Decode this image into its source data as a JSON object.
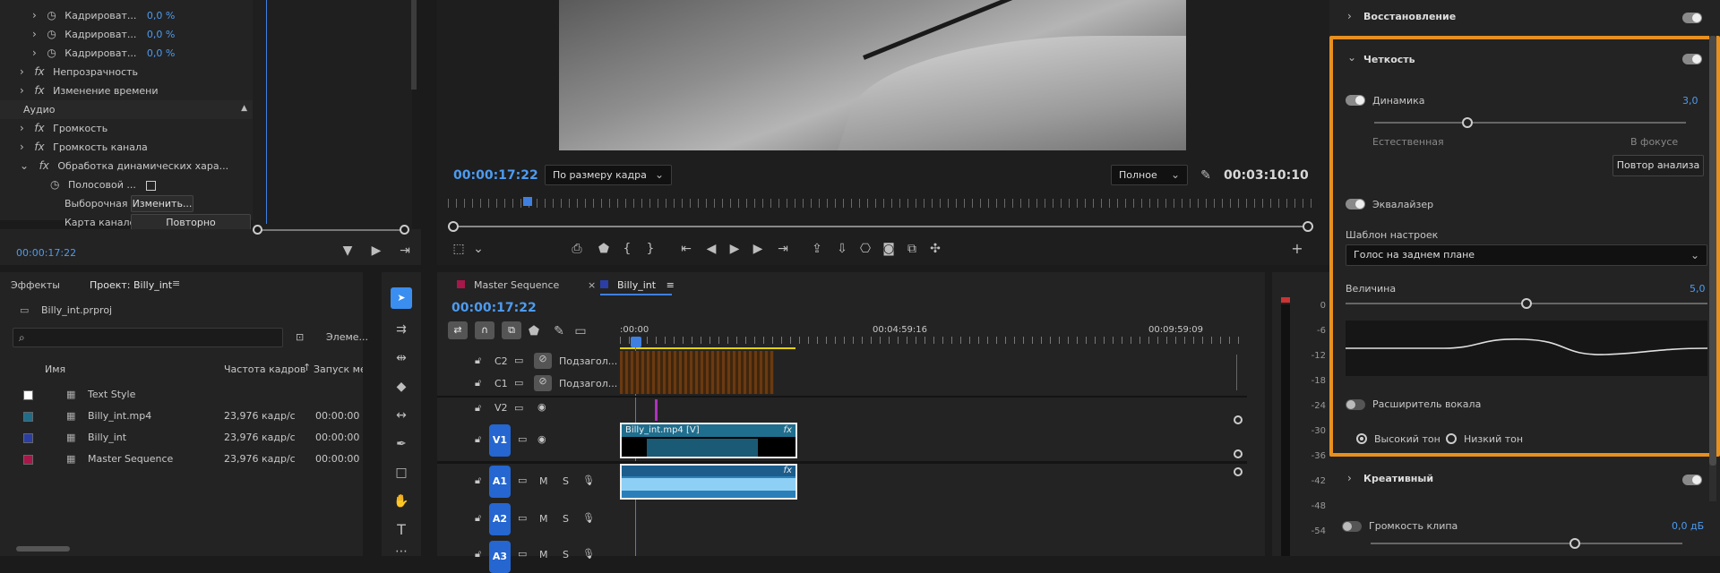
{
  "effect_controls": {
    "rows": [
      {
        "label": "Кадрироват...",
        "value": "0,0 %"
      },
      {
        "label": "Кадрироват...",
        "value": "0,0 %"
      },
      {
        "label": "Кадрироват...",
        "value": "0,0 %"
      },
      {
        "label": "Непрозрачность"
      },
      {
        "label": "Изменение времени"
      },
      {
        "label": "Аудио"
      },
      {
        "label": "Громкость"
      },
      {
        "label": "Громкость канала"
      },
      {
        "label": "Обработка динамических хара..."
      },
      {
        "label": "Полосовой ..."
      },
      {
        "label": "Выборочная у"
      },
      {
        "label": "Карта каналов"
      }
    ],
    "change_btn": "Изменить...",
    "remap_btn": "Повторно сопоставить...",
    "timecode": "00:00:17:22"
  },
  "program_monitor": {
    "timecode": "00:00:17:22",
    "fit_value": "По размеру кадра",
    "quality_value": "Полное",
    "duration": "00:03:10:10"
  },
  "project": {
    "tab_effects": "Эффекты",
    "tab_project": "Проект: Billy_int",
    "filename": "Billy_int.prproj",
    "elements": "Элеме...",
    "columns": {
      "name": "Имя",
      "fps": "Частота кадров",
      "start": "Запуск ме"
    },
    "items": [
      {
        "name": "Text Style",
        "fps": "",
        "start": "",
        "color": "#ffffff"
      },
      {
        "name": "Billy_int.mp4",
        "fps": "23,976 кадр/с",
        "start": "00:00:00",
        "color": "#1e6e8a"
      },
      {
        "name": "Billy_int",
        "fps": "23,976 кадр/с",
        "start": "00:00:00",
        "color": "#2a3ea6"
      },
      {
        "name": "Master Sequence",
        "fps": "23,976 кадр/с",
        "start": "00:00:00",
        "color": "#a8174a"
      }
    ]
  },
  "timeline": {
    "tab1": "Master Sequence",
    "tab2": "Billy_int",
    "timecode": "00:00:17:22",
    "ruler": [
      ":00:00",
      "00:04:59:16",
      "00:09:59:09"
    ],
    "tracks": {
      "c2": "C2",
      "c1": "C1",
      "sub": "Подзагол...",
      "v2": "V2",
      "v1": "V1",
      "a1": "A1",
      "a2": "A2",
      "a3": "A3",
      "m": "M",
      "s": "S"
    },
    "clip_v1": "Billy_int.mp4 [V]"
  },
  "meter_labels": [
    "0",
    "-6",
    "-12",
    "-18",
    "-24",
    "-30",
    "-36",
    "-42",
    "-48",
    "-54"
  ],
  "essential_sound": {
    "restore": "Восстановление",
    "clarity": "Четкость",
    "dynamics": "Динамика",
    "dynamics_value": "3,0",
    "dynamics_level": 0.3,
    "natural": "Естественная",
    "focused": "В фокусе",
    "reanalyze": "Повтор анализа",
    "eq": "Эквалайзер",
    "preset_label": "Шаблон настроек",
    "preset_value": "Голос на заднем плане",
    "amount_label": "Величина",
    "amount_value": "5,0",
    "amount_level": 0.5,
    "vocal_enhancer": "Расширитель вокала",
    "high_tone": "Высокий тон",
    "low_tone": "Низкий тон",
    "creative": "Креативный",
    "clip_volume": "Громкость клипа",
    "clip_volume_value": "0,0 дБ",
    "highlight_color": "#e8901f",
    "accent": "#4d9bf0"
  }
}
